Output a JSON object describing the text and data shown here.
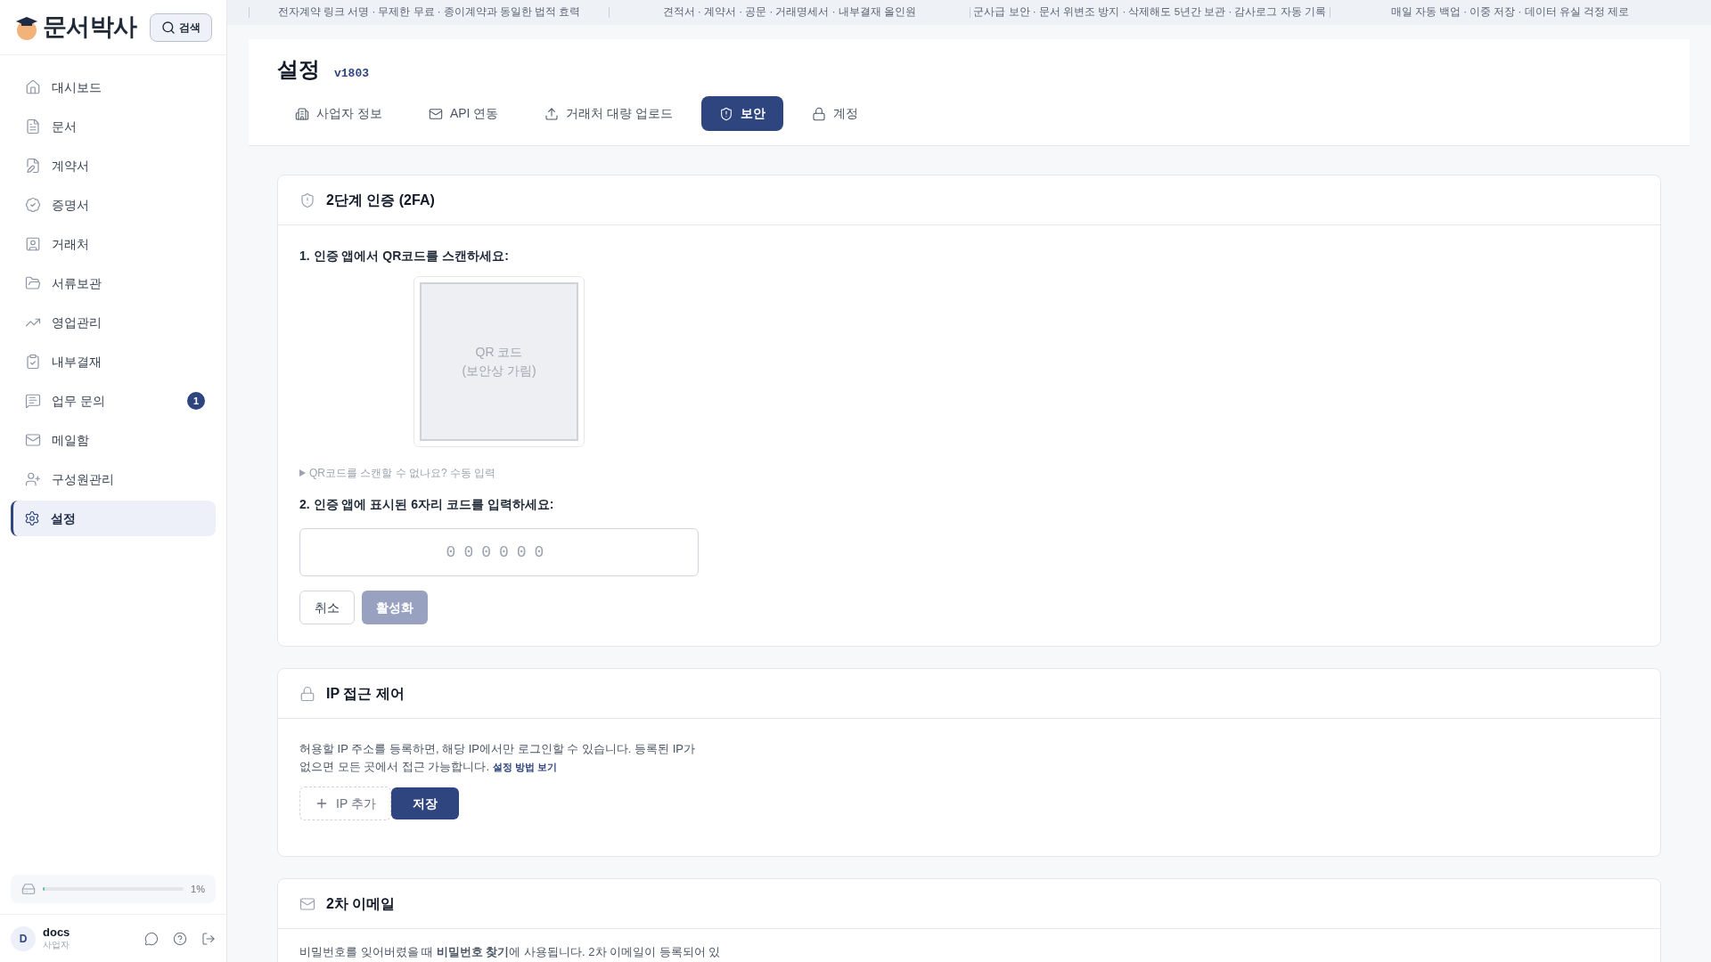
{
  "sidebar": {
    "logo": "문서박사",
    "search_button": "검색",
    "items": [
      {
        "label": "대시보드",
        "selected": false
      },
      {
        "label": "문서",
        "selected": false
      },
      {
        "label": "계약서",
        "selected": false
      },
      {
        "label": "증명서",
        "selected": false
      },
      {
        "label": "거래처",
        "selected": false
      },
      {
        "label": "서류보관",
        "selected": false
      },
      {
        "label": "영업관리",
        "selected": false
      },
      {
        "label": "내부결재",
        "selected": false
      },
      {
        "label": "업무 문의",
        "selected": false,
        "badge": "1"
      },
      {
        "label": "메일함",
        "selected": false
      },
      {
        "label": "구성원관리",
        "selected": false
      },
      {
        "label": "설정",
        "selected": true
      }
    ],
    "storage": {
      "level": 0.01,
      "reading": "1%"
    },
    "user": {
      "initial": "D",
      "name": "docs",
      "role": "사업자"
    }
  },
  "banner": [
    "전자계약 링크 서명 · 무제한 무료 · 종이계약과 동일한 법적 효력",
    "견적서 · 계약서 · 공문 · 거래명세서 · 내부결재 올인원",
    "군사급 보안 · 문서 위변조 방지 · 삭제해도 5년간 보관 · 감사로그 자동 기록",
    "매일 자동 백업 · 이중 저장 · 데이터 유실 걱정 제로"
  ],
  "page": {
    "title": "설정",
    "version": "v1803",
    "tabs": [
      {
        "label": "사업자 정보",
        "selected": false
      },
      {
        "label": "API 연동",
        "selected": false
      },
      {
        "label": "거래처 대량 업로드",
        "selected": false
      },
      {
        "label": "보안",
        "selected": true
      },
      {
        "label": "계정",
        "selected": false
      }
    ]
  },
  "two_factor": {
    "title": "2단계 인증 (2FA)",
    "step1": "1. 인증 앱에서 QR코드를 스캔하세요:",
    "qr_text": [
      "QR 코드",
      "(보안상 가림)"
    ],
    "manual_toggle": "QR코드를 스캔할 수 없나요? 수동 입력",
    "step2": "2. 인증 앱에 표시된 6자리 코드를 입력하세요:",
    "code_placeholder": "000000",
    "cancel": "취소",
    "activate": {
      "label": "활성화",
      "disabled": true
    }
  },
  "ip_access": {
    "title": "IP 접근 제어",
    "description": "허용할 IP 주소를 등록하면, 해당 IP에서만 로그인할 수 있습니다. 등록된 IP가 없으면 모든 곳에서 접근 가능합니다.",
    "link": "설정 방법 보기",
    "add_button": "IP 추가",
    "save_button": "저장"
  },
  "secondary_email": {
    "title": "2차 이메일",
    "description": "비밀번호를 잊어버렸을 때 **비밀번호 찾기**에 사용됩니다. 2차 이메일이 등록되어 있"
  }
}
